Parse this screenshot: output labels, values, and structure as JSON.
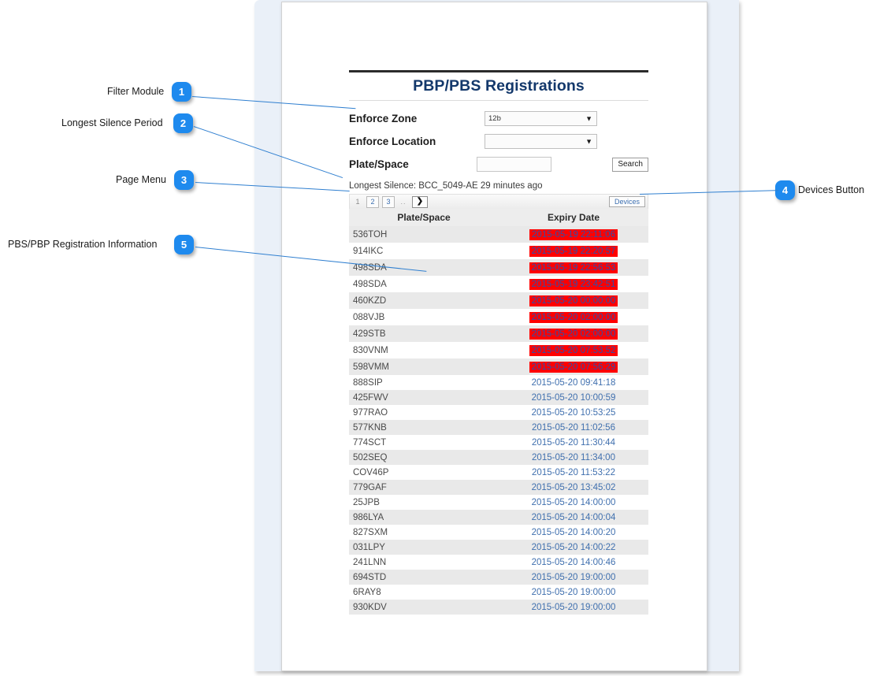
{
  "app": {
    "title": "PBP/PBS Registrations"
  },
  "filter": {
    "rows": [
      {
        "label": "Enforce Zone",
        "control": "select",
        "value": "12b"
      },
      {
        "label": "Enforce Location",
        "control": "select",
        "value": ""
      },
      {
        "label": "Plate/Space",
        "control": "text",
        "value": ""
      }
    ],
    "search_label": "Search",
    "caret_icon": "chevron-down-icon"
  },
  "silence": {
    "text": "Longest Silence: BCC_5049-AE 29 minutes ago"
  },
  "page_menu": {
    "pages": [
      "1",
      "2",
      "3"
    ],
    "current": "1",
    "ellipsis": "..",
    "next_icon": "chevron-right-icon",
    "next_label": "❯",
    "devices_label": "Devices"
  },
  "table": {
    "headers": [
      "Plate/Space",
      "Expiry Date"
    ],
    "rows": [
      {
        "plate": "536TOH",
        "expiry": "2015-05-19 22:11:06",
        "expired": true
      },
      {
        "plate": "914IKC",
        "expiry": "2015-05-19 22:20:57",
        "expired": true
      },
      {
        "plate": "498SDA",
        "expiry": "2015-05-19 22:56:53",
        "expired": true
      },
      {
        "plate": "498SDA",
        "expiry": "2015-05-19 23:42:51",
        "expired": true
      },
      {
        "plate": "460KZD",
        "expiry": "2015-05-20 00:00:00",
        "expired": true
      },
      {
        "plate": "088VJB",
        "expiry": "2015-05-20 02:00:00",
        "expired": true
      },
      {
        "plate": "429STB",
        "expiry": "2015-05-20 02:00:00",
        "expired": true
      },
      {
        "plate": "830VNM",
        "expiry": "2015-05-20 07:53:52",
        "expired": true
      },
      {
        "plate": "598VMM",
        "expiry": "2015-05-20 07:56:29",
        "expired": true
      },
      {
        "plate": "888SIP",
        "expiry": "2015-05-20 09:41:18",
        "expired": false
      },
      {
        "plate": "425FWV",
        "expiry": "2015-05-20 10:00:59",
        "expired": false
      },
      {
        "plate": "977RAO",
        "expiry": "2015-05-20 10:53:25",
        "expired": false
      },
      {
        "plate": "577KNB",
        "expiry": "2015-05-20 11:02:56",
        "expired": false
      },
      {
        "plate": "774SCT",
        "expiry": "2015-05-20 11:30:44",
        "expired": false
      },
      {
        "plate": "502SEQ",
        "expiry": "2015-05-20 11:34:00",
        "expired": false
      },
      {
        "plate": "COV46P",
        "expiry": "2015-05-20 11:53:22",
        "expired": false
      },
      {
        "plate": "779GAF",
        "expiry": "2015-05-20 13:45:02",
        "expired": false
      },
      {
        "plate": "25JPB",
        "expiry": "2015-05-20 14:00:00",
        "expired": false
      },
      {
        "plate": "986LYA",
        "expiry": "2015-05-20 14:00:04",
        "expired": false
      },
      {
        "plate": "827SXM",
        "expiry": "2015-05-20 14:00:20",
        "expired": false
      },
      {
        "plate": "031LPY",
        "expiry": "2015-05-20 14:00:22",
        "expired": false
      },
      {
        "plate": "241LNN",
        "expiry": "2015-05-20 14:00:46",
        "expired": false
      },
      {
        "plate": "694STD",
        "expiry": "2015-05-20 19:00:00",
        "expired": false
      },
      {
        "plate": "6RAY8",
        "expiry": "2015-05-20 19:00:00",
        "expired": false
      },
      {
        "plate": "930KDV",
        "expiry": "2015-05-20 19:00:00",
        "expired": false
      }
    ]
  },
  "annotations": [
    {
      "number": "1",
      "label": "Filter Module"
    },
    {
      "number": "2",
      "label": "Longest Silence Period"
    },
    {
      "number": "3",
      "label": "Page Menu"
    },
    {
      "number": "4",
      "label": "Devices Button"
    },
    {
      "number": "5",
      "label": "PBS/PBP Registration Information"
    }
  ],
  "colors": {
    "badge": "#1e8aee",
    "title": "#13386b",
    "expired_bg": "#ff0000",
    "link": "#3f6fae",
    "frame": "#eaf0f8"
  }
}
